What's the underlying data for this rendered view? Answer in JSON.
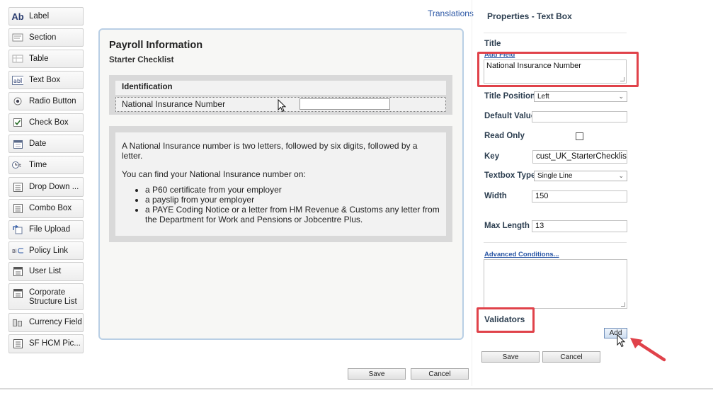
{
  "palette": {
    "items": [
      {
        "label": "Label",
        "icon": "label-icon"
      },
      {
        "label": "Section",
        "icon": "section-icon"
      },
      {
        "label": "Table",
        "icon": "table-icon"
      },
      {
        "label": "Text Box",
        "icon": "text-box-icon"
      },
      {
        "label": "Radio Button",
        "icon": "radio-button-icon"
      },
      {
        "label": "Check Box",
        "icon": "check-box-icon"
      },
      {
        "label": "Date",
        "icon": "calendar-icon"
      },
      {
        "label": "Time",
        "icon": "clock-icon"
      },
      {
        "label": "Drop Down ...",
        "icon": "drop-down-icon"
      },
      {
        "label": "Combo Box",
        "icon": "combo-box-icon"
      },
      {
        "label": "File Upload",
        "icon": "file-upload-icon"
      },
      {
        "label": "Policy Link",
        "icon": "policy-link-icon"
      },
      {
        "label": "User List",
        "icon": "user-list-icon"
      },
      {
        "label": "Corporate Structure List",
        "icon": "corporate-structure-icon"
      },
      {
        "label": "Currency Field",
        "icon": "currency-icon"
      },
      {
        "label": "SF HCM Pic...",
        "icon": "picker-icon"
      }
    ]
  },
  "canvas": {
    "translations_link": "Translations",
    "form_title": "Payroll Information",
    "form_subtitle": "Starter Checklist",
    "section_title": "Identification",
    "field_label": "National Insurance Number",
    "field_value": "",
    "info": {
      "paragraph1": "A National Insurance number is two letters, followed by six digits, followed by a letter.",
      "paragraph2": "You can find your National Insurance number on:",
      "bullets": [
        "a P60 certificate from your employer",
        "a payslip from your employer",
        "a PAYE Coding Notice or a letter from HM Revenue & Customs any letter from the Department for Work and Pensions or Jobcentre Plus."
      ]
    },
    "save_label": "Save",
    "cancel_label": "Cancel"
  },
  "properties": {
    "title": "Properties - Text Box",
    "title_label": "Title",
    "add_field_link": "Add Field",
    "title_value": "National Insurance Number",
    "title_position_label": "Title Position",
    "title_position_value": "Left",
    "default_value_label": "Default Value",
    "default_value": "",
    "read_only_label": "Read Only",
    "read_only_checked": false,
    "key_label": "Key",
    "key_value": "cust_UK_StarterChecklist_",
    "textbox_type_label": "Textbox Type",
    "textbox_type_value": "Single Line",
    "width_label": "Width",
    "width_value": "150",
    "max_length_label": "Max Length",
    "max_length_value": "13",
    "advanced_conditions_link": "Advanced Conditions...",
    "validators_label": "Validators",
    "add_label": "Add",
    "save_label": "Save",
    "cancel_label": "Cancel"
  },
  "colors": {
    "highlight_red": "#e0424a",
    "link_blue": "#2b57a5",
    "frame_blue": "#b9cfe5"
  }
}
